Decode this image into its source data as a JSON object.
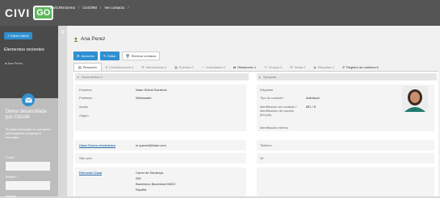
{
  "brand": {
    "logo_text": "CIVI",
    "logo_go": "GO",
    "accent": "#2f8fd0",
    "logo_green": "#5cb85c"
  },
  "breadcrumbs": [
    "CiviCRM Demo",
    "CiviCRM",
    "Ver contacto"
  ],
  "sidebar": {
    "new_button": "Crear nuevo",
    "recent_title": "Elementos recientes",
    "recent_items": [
      "Ana Perez"
    ],
    "collapse_label": "X",
    "promo": {
      "title": "Demo desarrollada por CiGAM",
      "description": "Si estás interesado en una demo personalizada completa el formulario",
      "email_label": "E-mail *",
      "name_label": "Nombre *",
      "message_label": "Mensaje"
    }
  },
  "contact": {
    "name": "Ana Perez",
    "actions": {
      "actions_label": "Acciones",
      "edit_label": "Editar",
      "delete_label": "Eliminar contacto"
    },
    "tabs": [
      {
        "label": "Resumen",
        "icon": "summary-icon"
      },
      {
        "label": "Contribuciones 0",
        "icon": "money-icon"
      },
      {
        "label": "Membresías 0",
        "icon": "member-icon"
      },
      {
        "label": "Eventos 0",
        "icon": "calendar-icon"
      },
      {
        "label": "Actividades 0",
        "icon": "activity-icon"
      },
      {
        "label": "Relaciones 1",
        "icon": "handshake-icon"
      },
      {
        "label": "Grupos 0",
        "icon": "group-icon"
      },
      {
        "label": "Notas 0",
        "icon": "note-icon"
      },
      {
        "label": "Etiquetas 0",
        "icon": "tag-icon"
      },
      {
        "label": "Registro de cambios 6",
        "icon": "history-icon"
      }
    ],
    "accordions": {
      "documents": "Documentos 0",
      "synopsis": "Synopsis"
    },
    "summary_left": [
      {
        "label": "Empresa",
        "value": "Islam Global Solutions"
      },
      {
        "label": "Profesión",
        "value": "Webmaster"
      },
      {
        "label": "Apodo",
        "value": ""
      },
      {
        "label": "Origen",
        "value": ""
      }
    ],
    "summary_right": [
      {
        "label": "Etiquetas",
        "value": ""
      },
      {
        "label": "Tipo de contacto",
        "value": "Individual"
      },
      {
        "label": "Identificador del contacto / Identificación de usuario (Drupal)",
        "value": "851 / 8"
      },
      {
        "label": "Identificador externo",
        "value": ""
      }
    ],
    "email": {
      "label": "Casa Correo electrónico",
      "value": "m.quenot@islam.com"
    },
    "phone": {
      "label": "Teléfono"
    },
    "website": {
      "label": "Sitio web"
    },
    "im": {
      "label": "IM"
    },
    "address": {
      "label": "Dirección Casa",
      "lines": [
        "Carrer de Sardenya",
        "259",
        "Barcelona, Barcelona 08013",
        "España"
      ]
    }
  }
}
